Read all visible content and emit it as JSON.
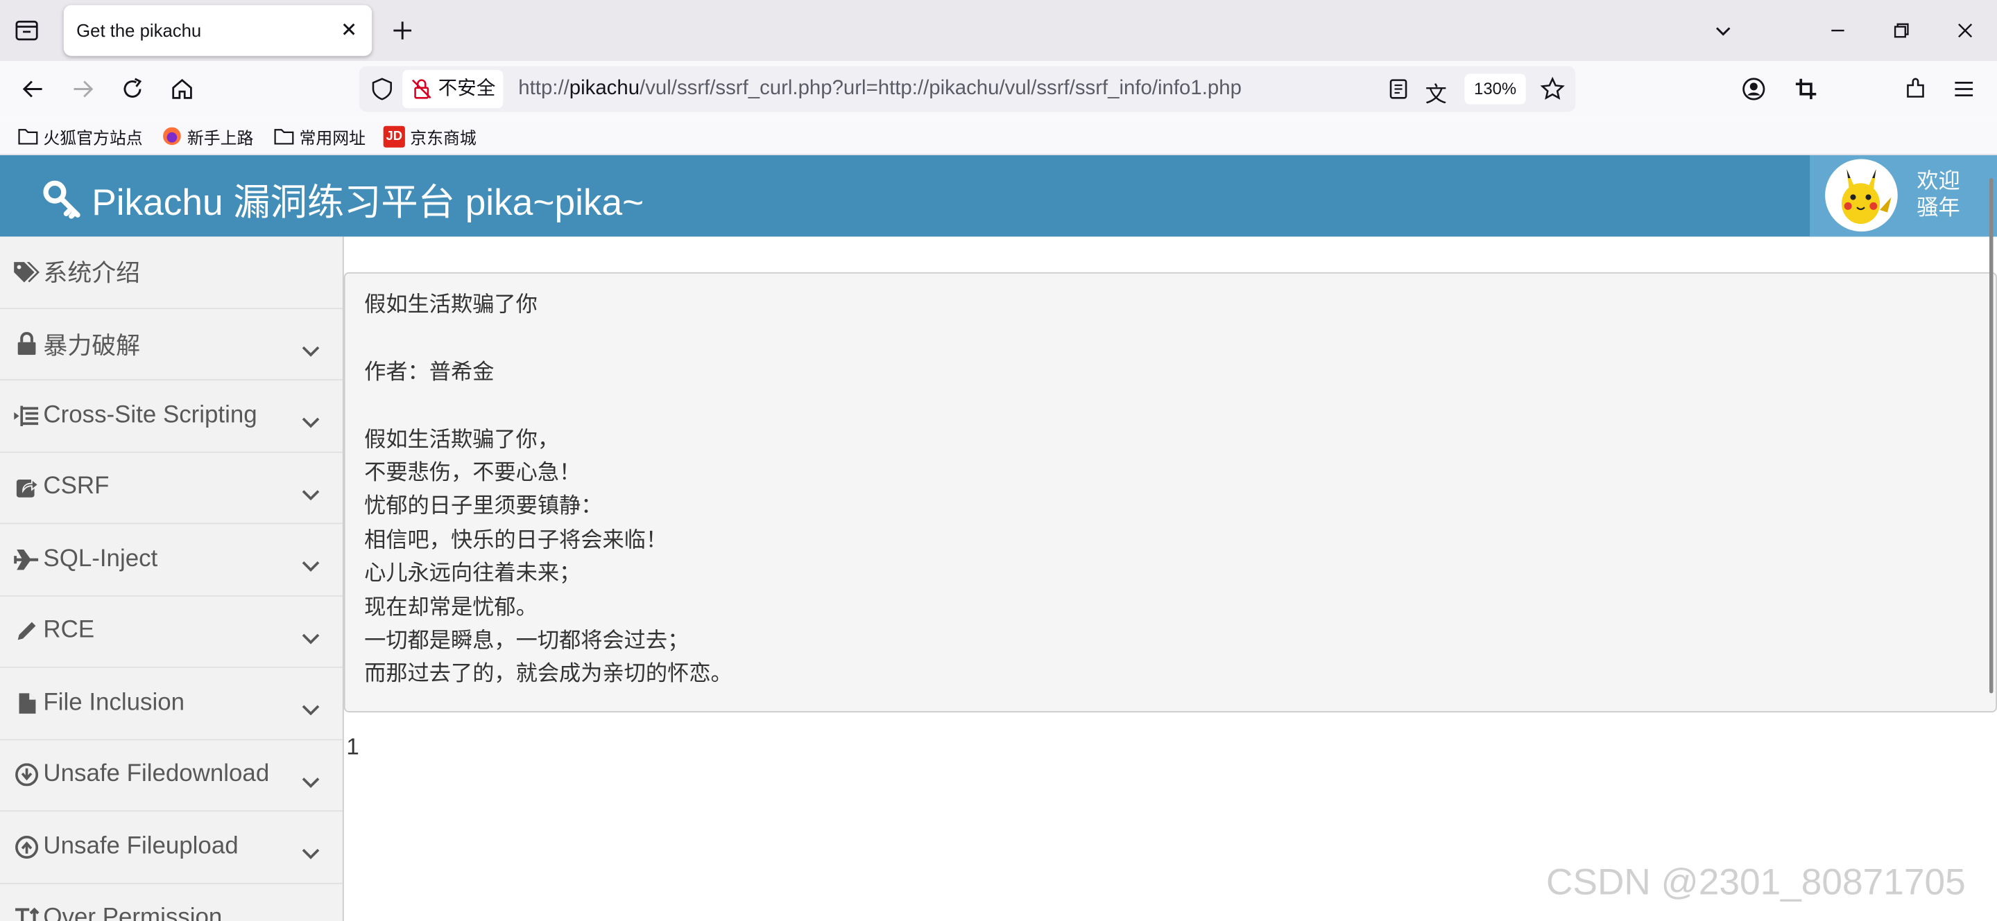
{
  "browser": {
    "tab_title": "Get the pikachu",
    "insecure_label": "不安全",
    "url_prefix": "http://",
    "url_host": "pikachu",
    "url_path": "/vul/ssrf/ssrf_curl.php?url=http://pikachu/vul/ssrf/ssrf_info/info1.php",
    "zoom": "130%",
    "bookmarks": [
      "火狐官方站点",
      "新手上路",
      "常用网址",
      "京东商城"
    ]
  },
  "header": {
    "title": "Pikachu 漏洞练习平台 pika~pika~",
    "welcome_line1": "欢迎",
    "welcome_line2": "骚年"
  },
  "sidebar": {
    "items": [
      {
        "label": "系统介绍",
        "icon": "tags-icon"
      },
      {
        "label": "暴力破解",
        "icon": "lock-icon"
      },
      {
        "label": "Cross-Site Scripting",
        "icon": "indent-icon"
      },
      {
        "label": "CSRF",
        "icon": "share-icon"
      },
      {
        "label": "SQL-Inject",
        "icon": "plane-icon"
      },
      {
        "label": "RCE",
        "icon": "pencil-icon"
      },
      {
        "label": "File Inclusion",
        "icon": "file-icon"
      },
      {
        "label": "Unsafe Filedownload",
        "icon": "download-icon"
      },
      {
        "label": "Unsafe Fileupload",
        "icon": "upload-icon"
      },
      {
        "label": "Over Permission",
        "icon": "text-height-icon"
      }
    ]
  },
  "content": {
    "lines": [
      "假如生活欺骗了你",
      "",
      "作者：普希金",
      "",
      "假如生活欺骗了你，",
      "不要悲伤，不要心急！",
      "忧郁的日子里须要镇静：",
      "相信吧，快乐的日子将会来临！",
      "心儿永远向往着未来；",
      "现在却常是忧郁。",
      "一切都是瞬息，一切都将会过去；",
      "而那过去了的，就会成为亲切的怀恋。"
    ],
    "result": "1"
  },
  "watermark": "CSDN @2301_80871705",
  "colors": {
    "header": "#438eb9",
    "user_box": "#62a8d1",
    "sidebar": "#f2f2f2"
  }
}
